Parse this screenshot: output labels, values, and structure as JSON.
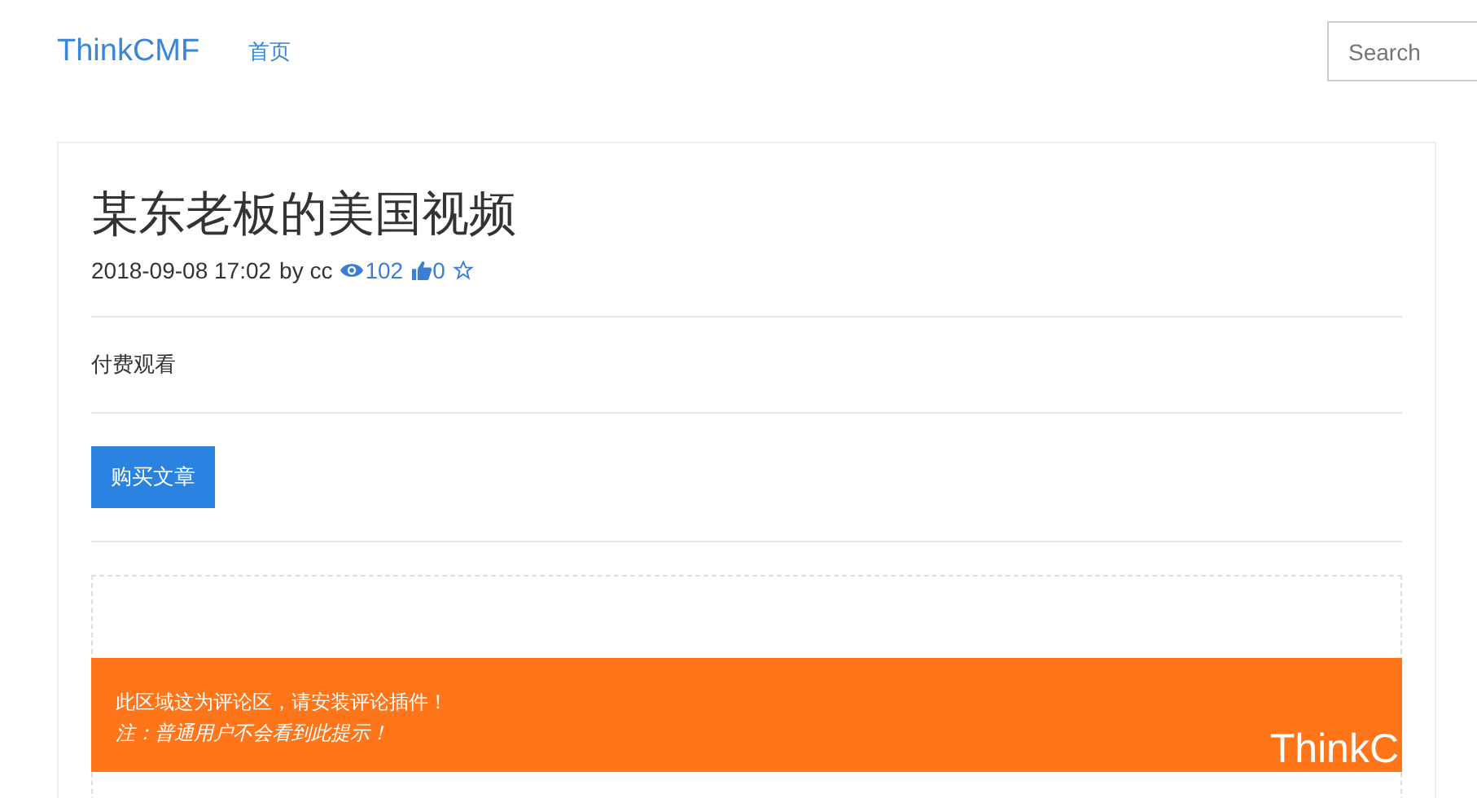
{
  "navbar": {
    "brand": "ThinkCMF",
    "links": [
      {
        "label": "首页",
        "selected": false
      }
    ],
    "search": {
      "placeholder": "Search"
    }
  },
  "article": {
    "title": "某东老板的美国视频",
    "date": "2018-09-08 17:02",
    "by": "by cc",
    "views": "102",
    "likes": "0",
    "favorited": false,
    "body": "付费观看",
    "buy_button": "购买文章"
  },
  "comment_notice": {
    "line_1": "此区域这为评论区，请安装评论插件！",
    "line_2": "注：普通用户不会看到此提示！",
    "logo_text": "ThinkC"
  }
}
